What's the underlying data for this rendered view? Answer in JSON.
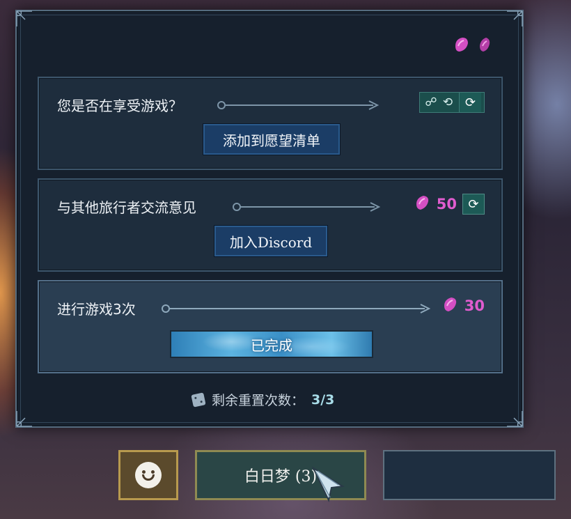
{
  "tasks": [
    {
      "title": "您是否在享受游戏？",
      "button_label": "添加到愿望清单",
      "reward_icons": [
        "wishlist-icon-1",
        "wishlist-icon-2"
      ]
    },
    {
      "title": "与其他旅行者交流意见",
      "reward_amount": "50",
      "button_label": "加入Discord"
    },
    {
      "title": "进行游戏3次",
      "reward_amount": "30",
      "status_label": "已完成"
    }
  ],
  "reroll": {
    "label": "剩余重置次数：",
    "count": "3/3"
  },
  "bottom_bar": {
    "daydream_label": "白日梦 (3)"
  },
  "colors": {
    "gem": "#d44fc3",
    "reward_text": "#e05ccf",
    "panel": "#16202d",
    "task_bg": "#1e2d3d",
    "button_blue": "#1b3d66"
  }
}
